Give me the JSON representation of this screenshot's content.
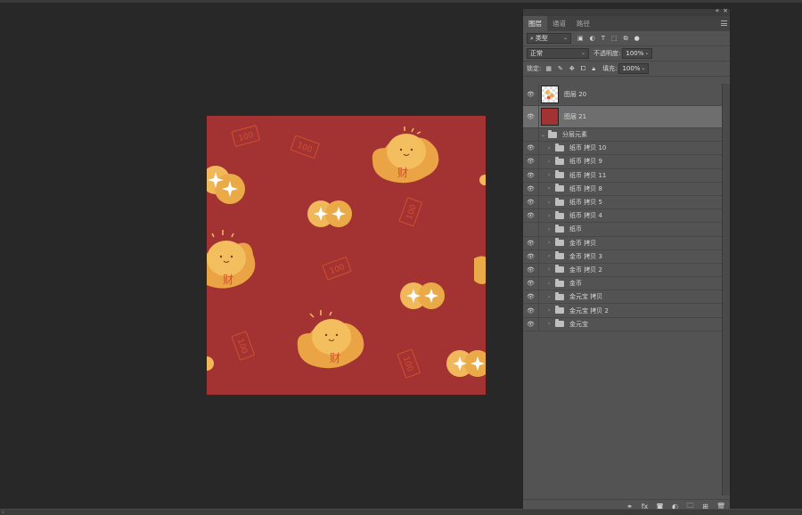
{
  "panel": {
    "tabs": [
      "图层",
      "通道",
      "路径"
    ],
    "filter_kind": "类型",
    "blend_mode": "正常",
    "opacity_label": "不透明度:",
    "opacity_value": "100%",
    "lock_label": "锁定:",
    "fill_label": "填充:",
    "fill_value": "100%",
    "layers": [
      {
        "name": "图层 20",
        "visible": true,
        "type": "pixel"
      },
      {
        "name": "图层 21",
        "visible": true,
        "type": "pixel",
        "selected": true
      },
      {
        "name": "分层元素",
        "visible": false,
        "type": "group-open"
      },
      {
        "name": "纸币 拷贝 10",
        "visible": true,
        "type": "group"
      },
      {
        "name": "纸币 拷贝 9",
        "visible": true,
        "type": "group"
      },
      {
        "name": "纸币 拷贝 11",
        "visible": true,
        "type": "group"
      },
      {
        "name": "纸币 拷贝 8",
        "visible": true,
        "type": "group"
      },
      {
        "name": "纸币 拷贝 5",
        "visible": true,
        "type": "group"
      },
      {
        "name": "纸币 拷贝 4",
        "visible": true,
        "type": "group"
      },
      {
        "name": "纸币",
        "visible": false,
        "type": "group"
      },
      {
        "name": "金币 拷贝",
        "visible": true,
        "type": "group"
      },
      {
        "name": "金币 拷贝 3",
        "visible": true,
        "type": "group"
      },
      {
        "name": "金币 拷贝 2",
        "visible": true,
        "type": "group"
      },
      {
        "name": "金币",
        "visible": true,
        "type": "group"
      },
      {
        "name": "金元宝 拷贝",
        "visible": true,
        "type": "group"
      },
      {
        "name": "金元宝 拷贝 2",
        "visible": true,
        "type": "group"
      },
      {
        "name": "金元宝",
        "visible": true,
        "type": "group"
      }
    ]
  },
  "canvas": {
    "background": "#a33333",
    "gold": "#f0b85a",
    "gold_dark": "#e6a041",
    "red_mark": "#d0502c",
    "ingot_char": "财",
    "bill_text": "100"
  },
  "footer_icons": [
    "link-icon",
    "fx-icon",
    "mask-icon",
    "adjustment-icon",
    "folder-icon",
    "new-layer-icon",
    "trash-icon"
  ]
}
